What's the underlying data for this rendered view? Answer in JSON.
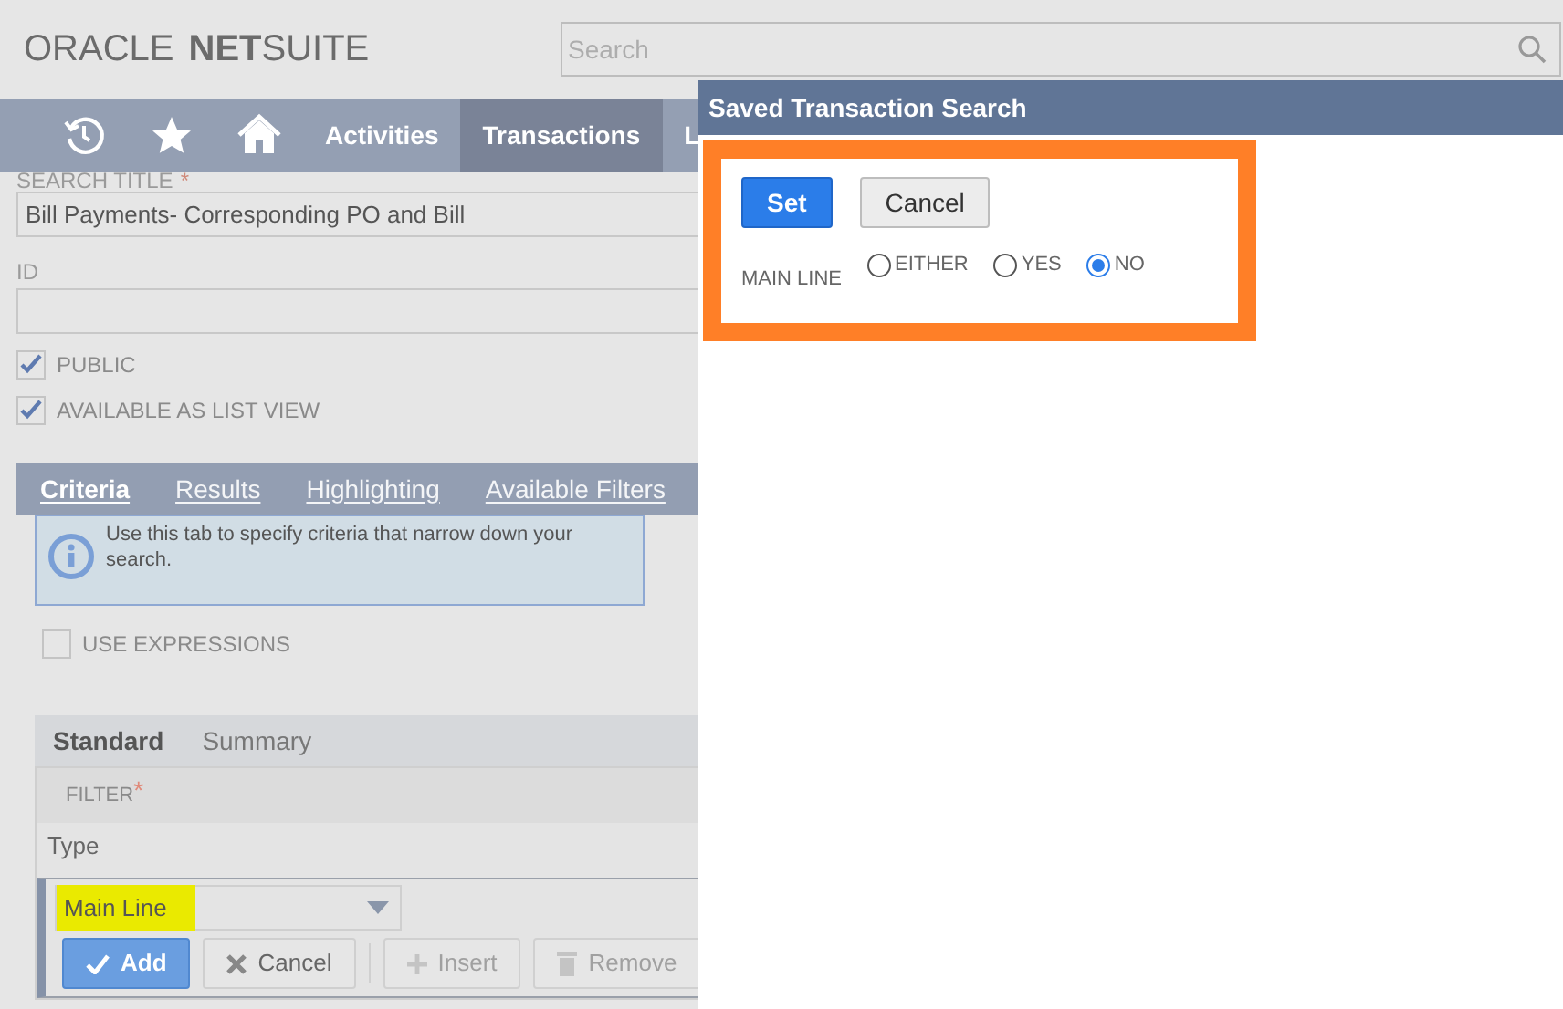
{
  "header": {
    "logo": {
      "brand": "ORACLE",
      "product_bold": "NET",
      "product_rest": "SUITE"
    },
    "search": {
      "placeholder": "Search"
    }
  },
  "nav": {
    "items": [
      {
        "kind": "icon",
        "selected": false
      },
      {
        "kind": "icon",
        "selected": false
      },
      {
        "kind": "icon",
        "selected": false
      },
      {
        "kind": "text",
        "label": "Activities",
        "selected": false
      },
      {
        "kind": "text",
        "label": "Transactions",
        "selected": true
      },
      {
        "kind": "text",
        "label": "L",
        "selected": false
      }
    ]
  },
  "form": {
    "search_title": {
      "label": "SEARCH TITLE",
      "required_mark": "*",
      "value": "Bill Payments- Corresponding PO and Bill"
    },
    "id": {
      "label": "ID"
    },
    "checkboxes": [
      {
        "label": "PUBLIC",
        "checked": true
      },
      {
        "label": "AVAILABLE AS LIST VIEW",
        "checked": true
      }
    ]
  },
  "tabs": [
    {
      "label": "Criteria",
      "selected": true
    },
    {
      "label": "Results",
      "selected": false
    },
    {
      "label": "Highlighting",
      "selected": false
    },
    {
      "label": "Available Filters",
      "selected": false
    }
  ],
  "info": "Use this tab to specify criteria that narrow down your search.",
  "use_expressions": {
    "label": "USE EXPRESSIONS",
    "checked": false
  },
  "subtabs": [
    {
      "label": "Standard",
      "selected": true
    },
    {
      "label": "Summary",
      "selected": false
    }
  ],
  "filter_table": {
    "column": "FILTER",
    "required_mark": "*",
    "row_label": "Type",
    "select_value": "Main Line"
  },
  "row_buttons": [
    {
      "label": "Add",
      "disabled": false,
      "primary": true
    },
    {
      "label": "Cancel",
      "disabled": false,
      "primary": false
    },
    {
      "label": "Insert",
      "disabled": true,
      "primary": false
    },
    {
      "label": "Remove",
      "disabled": true,
      "primary": false
    }
  ],
  "dialog": {
    "title": "Saved Transaction Search",
    "buttons": [
      {
        "label": "Set",
        "primary": true
      },
      {
        "label": "Cancel",
        "primary": false
      }
    ],
    "field_label": "MAIN LINE",
    "options": [
      {
        "label": "EITHER",
        "selected": false
      },
      {
        "label": "YES",
        "selected": false
      },
      {
        "label": "NO",
        "selected": true
      }
    ]
  }
}
